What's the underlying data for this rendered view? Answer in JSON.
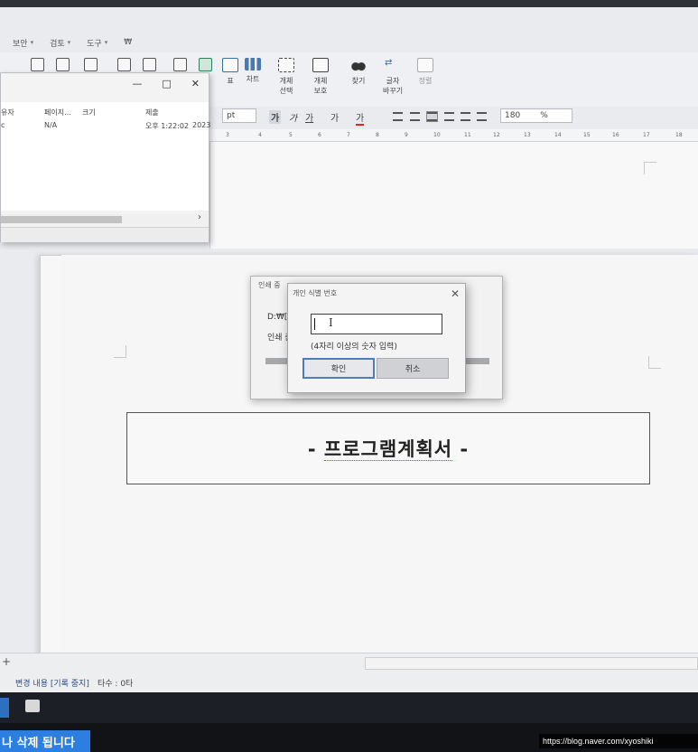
{
  "menu": {
    "items": [
      {
        "label": "보안"
      },
      {
        "label": "검토"
      },
      {
        "label": "도구"
      }
    ],
    "extra": "₩"
  },
  "ribbon": {
    "table_label": "표",
    "chart_label": "차트",
    "select_object": [
      "개체",
      "선택"
    ],
    "protect_object": [
      "개체",
      "보호"
    ],
    "find": [
      "찾기"
    ],
    "replace": [
      "글자",
      "바꾸기"
    ],
    "sort": [
      "정렬"
    ]
  },
  "format_bar": {
    "unit": "pt",
    "zoom": "180",
    "zoom_unit": "%",
    "bold": "가",
    "italic": "가",
    "underline": "가",
    "strike": "가",
    "color": "가"
  },
  "ruler": {
    "ticks": [
      "3",
      "4",
      "5",
      "6",
      "7",
      "8",
      "9",
      "10",
      "11",
      "12",
      "13",
      "14",
      "15",
      "16",
      "17",
      "18"
    ]
  },
  "file_window": {
    "columns": [
      "유자",
      "페이지...",
      "크기",
      "제출"
    ],
    "row": {
      "col1": "c",
      "pages": "N/A",
      "size": "",
      "submitted": "오후 1:22:02",
      "year": "2023"
    },
    "controls": {
      "minimize": "—",
      "maximize": "□",
      "close": "✕"
    },
    "scroll_right": "›"
  },
  "print_dialog": {
    "title": "인쇄 중",
    "path": "D:₩[0",
    "status": "인쇄 준"
  },
  "pin_dialog": {
    "title": "개인 식별 번호",
    "close": "✕",
    "input_value": "",
    "hint": "(4자리 이상의 숫자 입력)",
    "ok_label": "확인",
    "cancel_label": "취소"
  },
  "document": {
    "title": "- 프로그램계획서 -",
    "title_prefix": "- ",
    "title_main": "프로그램계획서",
    "title_suffix": " -"
  },
  "status": {
    "changes": "변경 내용 [기록 중지]",
    "count": "타수 : 0타",
    "add_tab": "+"
  },
  "notification": "나 삭제 됩니다",
  "watermark": "https://blog.naver.com/xyoshiki"
}
